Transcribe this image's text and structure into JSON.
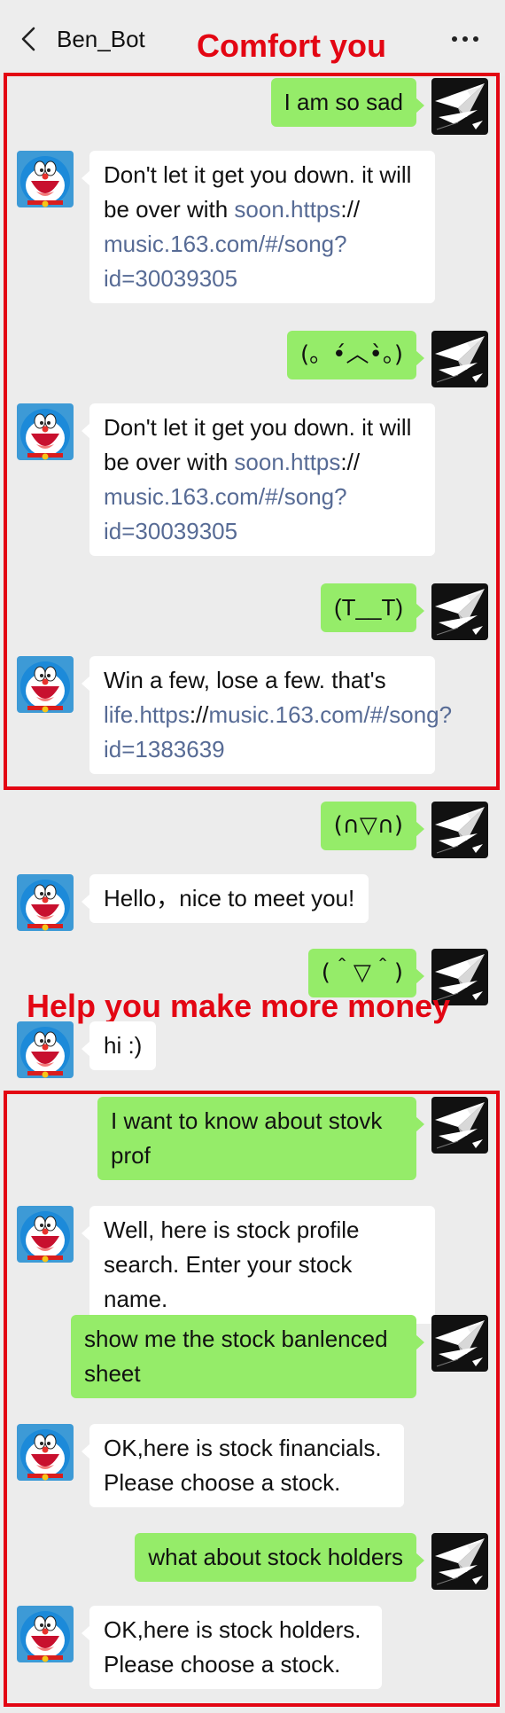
{
  "header": {
    "title": "Ben_Bot"
  },
  "annotations": {
    "comfort": "Comfort you",
    "money": "Help you make more money"
  },
  "messages": [
    {
      "from": "user",
      "text": "I am so sad"
    },
    {
      "from": "bot",
      "parts": [
        "Don't let it get you down. it will be over with ",
        "soon.https",
        "://",
        "music.163.com/#/song?id=30039305"
      ]
    },
    {
      "from": "user",
      "text": "(。•́︿•̀。)"
    },
    {
      "from": "bot",
      "parts": [
        "Don't let it get you down. it will be over with ",
        "soon.https",
        "://",
        "music.163.com/#/song?id=30039305"
      ]
    },
    {
      "from": "user",
      "text": "(T__T)"
    },
    {
      "from": "bot",
      "parts": [
        "Win a few, lose a few. that's ",
        "life.https",
        "://",
        "music.163.com/#/song?id=1383639"
      ]
    },
    {
      "from": "user",
      "text": "(∩▽∩)"
    },
    {
      "from": "bot",
      "text": "Hello，nice to meet you!"
    },
    {
      "from": "user",
      "text": "(＾▽＾)"
    },
    {
      "from": "bot",
      "text": "hi :)"
    },
    {
      "from": "user",
      "text": "I want to know about stovk prof"
    },
    {
      "from": "bot",
      "text": "Well, here is stock profile search. Enter your stock name."
    },
    {
      "from": "user",
      "text": "show me the stock banlenced sheet"
    },
    {
      "from": "bot",
      "text": "OK,here is stock financials. Please choose a stock."
    },
    {
      "from": "user",
      "text": "what about stock holders"
    },
    {
      "from": "bot",
      "text": "OK,here is stock holders. Please choose a stock."
    }
  ],
  "colors": {
    "user_bubble": "#95ec69",
    "bot_bubble": "#ffffff",
    "link": "#576b95",
    "annotation": "#e30613",
    "background": "#ececec"
  },
  "icons": {
    "back": "chevron-left-icon",
    "more": "more-dots-icon",
    "bot_avatar": "doraemon-avatar",
    "user_avatar": "paper-plane-avatar"
  }
}
